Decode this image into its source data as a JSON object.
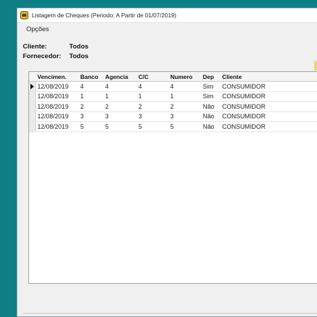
{
  "window": {
    "title": "Listagem de Cheques (Periodo: A Partir de 01/07/2019)"
  },
  "menu": {
    "items": [
      {
        "label": "Opções"
      }
    ]
  },
  "filters": {
    "cliente": {
      "label": "Cliente:",
      "value": "Todos"
    },
    "fornecedor": {
      "label": "Fornecedor:",
      "value": "Todos"
    }
  },
  "table": {
    "columns": [
      "Vencimen.",
      "Banco",
      "Agencia",
      "C/C",
      "Numero",
      "Dep",
      "Cliente"
    ],
    "rows": [
      [
        "12/08/2019",
        "4",
        "4",
        "4",
        "4",
        "Sim",
        "CONSUMIDOR"
      ],
      [
        "12/08/2019",
        "1",
        "1",
        "1",
        "1",
        "Sim",
        "CONSUMIDOR"
      ],
      [
        "12/08/2019",
        "2",
        "2",
        "2",
        "2",
        "Não",
        "CONSUMIDOR"
      ],
      [
        "12/08/2019",
        "3",
        "3",
        "3",
        "3",
        "Não",
        "CONSUMIDOR"
      ],
      [
        "12/08/2019",
        "5",
        "5",
        "5",
        "5",
        "Não",
        "CONSUMIDOR"
      ]
    ],
    "selected_row": 0
  },
  "colors": {
    "desktop": "#0f7f86",
    "window_bg": "#f0f0f0",
    "grid_bg": "#ffffff"
  }
}
